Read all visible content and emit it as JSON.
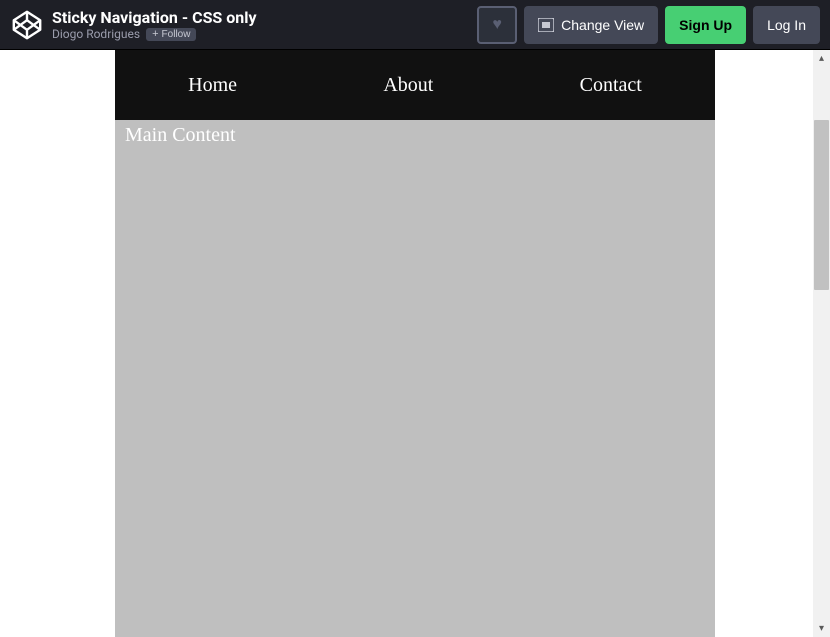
{
  "header": {
    "title": "Sticky Navigation - CSS only",
    "author": "Diogo Rodrigues",
    "follow_label": "Follow",
    "change_view_label": "Change View",
    "signup_label": "Sign Up",
    "login_label": "Log In"
  },
  "nav": {
    "items": [
      {
        "label": "Home"
      },
      {
        "label": "About"
      },
      {
        "label": "Contact"
      }
    ]
  },
  "main": {
    "heading": "Main Content"
  }
}
